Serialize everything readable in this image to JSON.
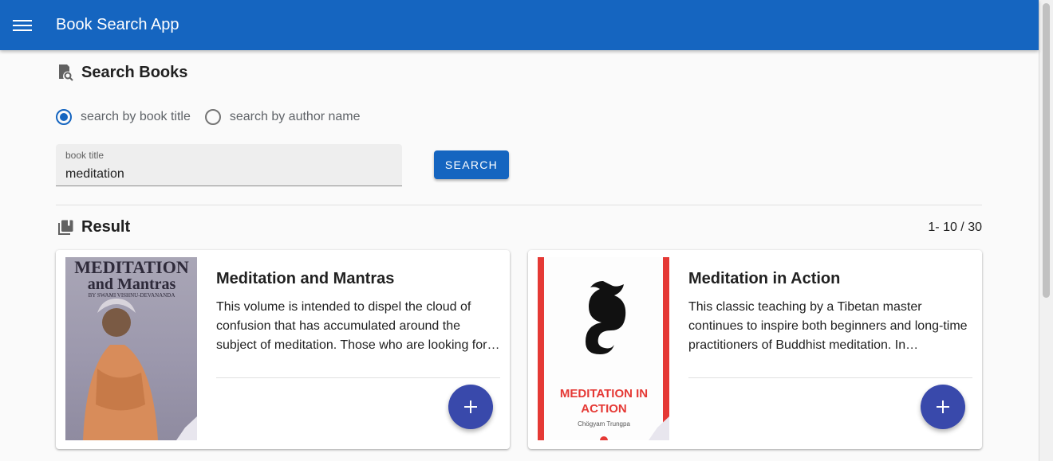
{
  "app_bar": {
    "title": "Book Search App"
  },
  "search": {
    "heading": "Search Books",
    "options": [
      {
        "label": "search by book title",
        "checked": true
      },
      {
        "label": "search by author name",
        "checked": false
      }
    ],
    "field_label": "book title",
    "field_value": "meditation",
    "button_label": "SEARCH"
  },
  "results": {
    "heading": "Result",
    "count": "1- 10 / 30",
    "books": [
      {
        "title": "Meditation and Mantras",
        "description": "This volume is intended to dispel the cloud of confusion that has accumulated around the subject of meditation. Those who are looking for…",
        "cover": {
          "line1": "MEDITATION",
          "line2": "and Mantras",
          "line3": "BY SWAMI VISHNU-DEVANANDA"
        }
      },
      {
        "title": "Meditation in Action",
        "description": "This classic teaching by a Tibetan master continues to inspire both beginners and long-time practitioners of Buddhist meditation. In…",
        "cover": {
          "line1": "MEDITATION IN",
          "line2": "ACTION",
          "line3": "Chögyam Trungpa"
        }
      }
    ]
  },
  "colors": {
    "primary": "#1565c0",
    "fab": "#3949ab",
    "cover_red": "#e53935"
  },
  "icons": [
    "menu-icon",
    "book-search-icon",
    "library-books-icon",
    "add-icon"
  ]
}
